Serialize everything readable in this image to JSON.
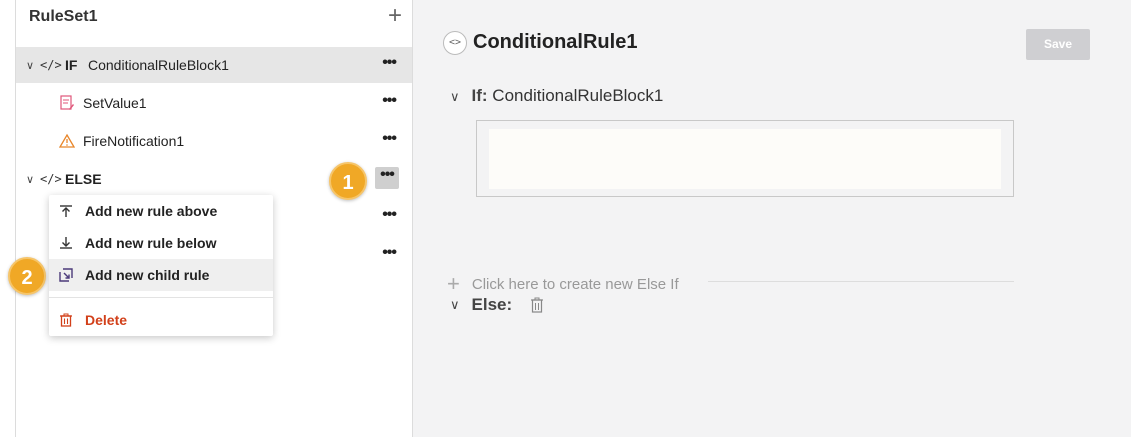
{
  "tree": {
    "title": "RuleSet1",
    "add_icon": "plus-icon",
    "if_row": {
      "keyword": "IF",
      "label": "ConditionalRuleBlock1"
    },
    "children": [
      {
        "label": "SetValue1",
        "icon": "set-value-icon"
      },
      {
        "label": "FireNotification1",
        "icon": "warning-icon"
      }
    ],
    "else_row": {
      "keyword": "ELSE"
    },
    "more_glyph": "•••",
    "code_glyph": "</>",
    "chevron_glyph": "∨"
  },
  "callouts": {
    "one": "1",
    "two": "2"
  },
  "context_menu": {
    "items": [
      {
        "label": "Add new rule above",
        "icon": "insert-above-icon"
      },
      {
        "label": "Add new rule below",
        "icon": "insert-below-icon"
      },
      {
        "label": "Add new child rule",
        "icon": "add-child-icon"
      },
      {
        "label": "Delete",
        "icon": "trash-icon"
      }
    ]
  },
  "editor": {
    "title": "ConditionalRule1",
    "code_toggle_glyph": "<>",
    "save_label": "Save",
    "if_label": "If:",
    "if_block": "ConditionalRuleBlock1",
    "else_if_prompt": "Click here to create new Else If",
    "else_label": "Else:"
  },
  "colors": {
    "accent_badge": "#f0a826",
    "danger": "#d2401a",
    "selected_row": "#e6e6e6"
  }
}
